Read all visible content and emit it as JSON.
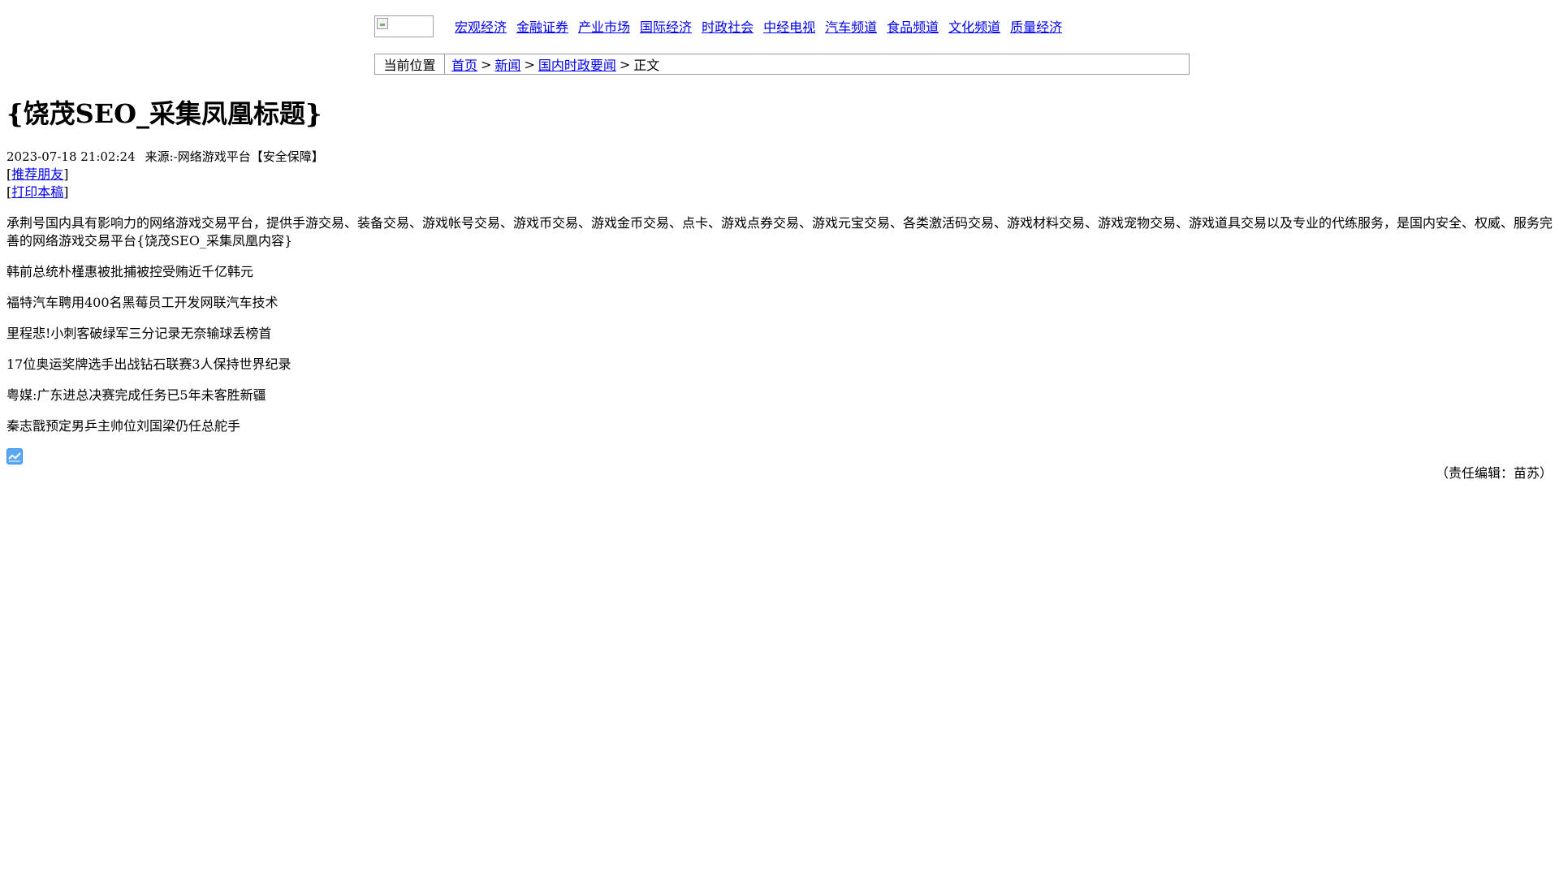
{
  "nav": {
    "logo_icon": "broken-image-icon",
    "links": [
      "宏观经济",
      "金融证券",
      "产业市场",
      "国际经济",
      "时政社会",
      "中经电视",
      "汽车频道",
      "食品频道",
      "文化频道",
      "质量经济"
    ]
  },
  "breadcrumb": {
    "label": "当前位置",
    "items": [
      "首页",
      "新闻",
      "国内时政要闻"
    ],
    "separator": ">",
    "current": "正文"
  },
  "article": {
    "title": "{饶茂SEO_采集凤凰标题}",
    "datetime": "2023-07-18 21:02:24",
    "source": "来源:-网络游戏平台【安全保障】",
    "tools": [
      "推荐朋友",
      "打印本稿"
    ],
    "intro": "承荆号国内具有影响力的网络游戏交易平台，提供手游交易、装备交易、游戏帐号交易、游戏币交易、游戏金币交易、点卡、游戏点券交易、游戏元宝交易、各类激活码交易、游戏材料交易、游戏宠物交易、游戏道具交易以及专业的代练服务，是国内安全、权威、服务完善的网络游戏交易平台{饶茂SEO_采集凤凰内容}",
    "headlines": [
      "韩前总统朴槿惠被批捕被控受贿近千亿韩元",
      "福特汽车聘用400名黑莓员工开发网联汽车技术",
      "里程悲!小刺客破绿军三分记录无奈输球丢榜首",
      "17位奥运奖牌选手出战钻石联赛3人保持世界纪录",
      "粤媒:广东进总决赛完成任务已5年未客胜新疆",
      "秦志戬预定男乒主帅位刘国梁仍任总舵手"
    ],
    "icon": "chart-icon",
    "editor": "（责任编辑：苗苏）"
  }
}
